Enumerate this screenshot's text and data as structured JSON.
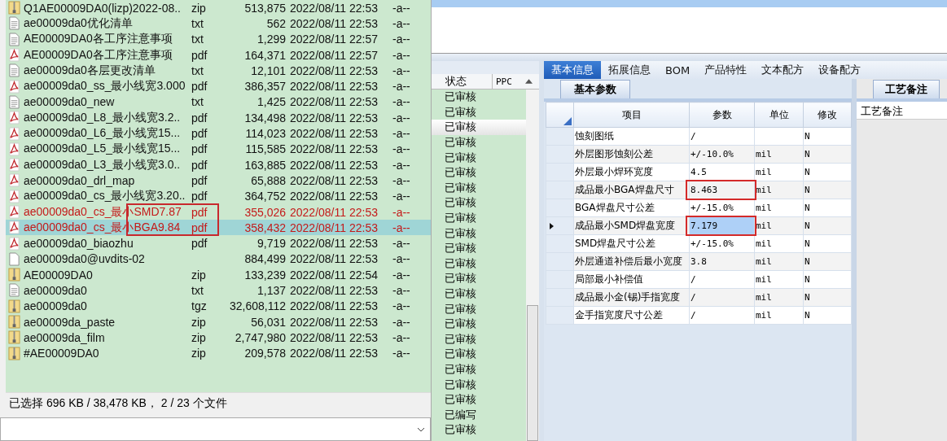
{
  "file_list": {
    "rows": [
      {
        "kind": "archive",
        "name": "Q1AE00009DA0(lizp)2022-08..",
        "type": "zip",
        "size": "513,875",
        "modified": "2022/08/11 22:53",
        "attributes": "-a--",
        "marked": false,
        "selected": false,
        "boxed": false
      },
      {
        "kind": "text",
        "name": "ae00009da0优化清单",
        "type": "txt",
        "size": "562",
        "modified": "2022/08/11 22:53",
        "attributes": "-a--",
        "marked": false,
        "selected": false,
        "boxed": false
      },
      {
        "kind": "text",
        "name": "AE00009DA0各工序注意事项",
        "type": "txt",
        "size": "1,299",
        "modified": "2022/08/11 22:57",
        "attributes": "-a--",
        "marked": false,
        "selected": false,
        "boxed": false
      },
      {
        "kind": "acrobat",
        "name": "AE00009DA0各工序注意事项",
        "type": "pdf",
        "size": "164,371",
        "modified": "2022/08/11 22:57",
        "attributes": "-a--",
        "marked": false,
        "selected": false,
        "boxed": false
      },
      {
        "kind": "text",
        "name": "ae00009da0各层更改清单",
        "type": "txt",
        "size": "12,101",
        "modified": "2022/08/11 22:53",
        "attributes": "-a--",
        "marked": false,
        "selected": false,
        "boxed": false
      },
      {
        "kind": "acrobat",
        "name": "ae00009da0_ss_最小线宽3.000",
        "type": "pdf",
        "size": "386,357",
        "modified": "2022/08/11 22:53",
        "attributes": "-a--",
        "marked": false,
        "selected": false,
        "boxed": false
      },
      {
        "kind": "text",
        "name": "ae00009da0_new",
        "type": "txt",
        "size": "1,425",
        "modified": "2022/08/11 22:53",
        "attributes": "-a--",
        "marked": false,
        "selected": false,
        "boxed": false
      },
      {
        "kind": "acrobat",
        "name": "ae00009da0_L8_最小线宽3.2..",
        "type": "pdf",
        "size": "134,498",
        "modified": "2022/08/11 22:53",
        "attributes": "-a--",
        "marked": false,
        "selected": false,
        "boxed": false
      },
      {
        "kind": "acrobat",
        "name": "ae00009da0_L6_最小线宽15...",
        "type": "pdf",
        "size": "114,023",
        "modified": "2022/08/11 22:53",
        "attributes": "-a--",
        "marked": false,
        "selected": false,
        "boxed": false
      },
      {
        "kind": "acrobat",
        "name": "ae00009da0_L5_最小线宽15...",
        "type": "pdf",
        "size": "115,585",
        "modified": "2022/08/11 22:53",
        "attributes": "-a--",
        "marked": false,
        "selected": false,
        "boxed": false
      },
      {
        "kind": "acrobat",
        "name": "ae00009da0_L3_最小线宽3.0..",
        "type": "pdf",
        "size": "163,885",
        "modified": "2022/08/11 22:53",
        "attributes": "-a--",
        "marked": false,
        "selected": false,
        "boxed": false
      },
      {
        "kind": "acrobat",
        "name": "ae00009da0_drl_map",
        "type": "pdf",
        "size": "65,888",
        "modified": "2022/08/11 22:53",
        "attributes": "-a--",
        "marked": false,
        "selected": false,
        "boxed": false
      },
      {
        "kind": "acrobat",
        "name": "ae00009da0_cs_最小线宽3.20..",
        "type": "pdf",
        "size": "364,752",
        "modified": "2022/08/11 22:53",
        "attributes": "-a--",
        "marked": false,
        "selected": false,
        "boxed": false
      },
      {
        "kind": "acrobat",
        "name": "ae00009da0_cs_最小SMD7.87",
        "type": "pdf",
        "size": "355,026",
        "modified": "2022/08/11 22:53",
        "attributes": "-a--",
        "marked": true,
        "selected": false,
        "boxed": true
      },
      {
        "kind": "acrobat",
        "name": "ae00009da0_cs_最小BGA9.84",
        "type": "pdf",
        "size": "358,432",
        "modified": "2022/08/11 22:53",
        "attributes": "-a--",
        "marked": true,
        "selected": true,
        "boxed": true
      },
      {
        "kind": "acrobat",
        "name": "ae00009da0_biaozhu",
        "type": "pdf",
        "size": "9,719",
        "modified": "2022/08/11 22:53",
        "attributes": "-a--",
        "marked": false,
        "selected": false,
        "boxed": false
      },
      {
        "kind": "plain",
        "name": "ae00009da0@uvdits-02",
        "size": "884,499",
        "modified": "2022/08/11 22:53",
        "attributes": "-a--",
        "marked": false,
        "selected": false,
        "boxed": false
      },
      {
        "kind": "archive",
        "name": "AE00009DA0",
        "type": "zip",
        "size": "133,239",
        "modified": "2022/08/11 22:54",
        "attributes": "-a--",
        "marked": false,
        "selected": false,
        "boxed": false
      },
      {
        "kind": "text",
        "name": "ae00009da0",
        "type": "txt",
        "size": "1,137",
        "modified": "2022/08/11 22:53",
        "attributes": "-a--",
        "marked": false,
        "selected": false,
        "boxed": false
      },
      {
        "kind": "archive",
        "name": "ae00009da0",
        "type": "tgz",
        "size": "32,608,112",
        "modified": "2022/08/11 22:53",
        "attributes": "-a--",
        "marked": false,
        "selected": false,
        "boxed": false
      },
      {
        "kind": "archive",
        "name": "ae00009da_paste",
        "type": "zip",
        "size": "56,031",
        "modified": "2022/08/11 22:53",
        "attributes": "-a--",
        "marked": false,
        "selected": false,
        "boxed": false
      },
      {
        "kind": "archive",
        "name": "ae00009da_film",
        "type": "zip",
        "size": "2,747,980",
        "modified": "2022/08/11 22:53",
        "attributes": "-a--",
        "marked": false,
        "selected": false,
        "boxed": false
      },
      {
        "kind": "archive",
        "name": "#AE00009DA0",
        "type": "zip",
        "size": "209,578",
        "modified": "2022/08/11 22:53",
        "attributes": "-a--",
        "marked": false,
        "selected": false,
        "boxed": false
      }
    ],
    "status_text": "已选择 696 KB / 38,478 KB， 2 / 23 个文件"
  },
  "status_list": {
    "columns": [
      "状态",
      "PPC"
    ],
    "rows": [
      {
        "status": "已审核",
        "selected": false
      },
      {
        "status": "已审核",
        "selected": false
      },
      {
        "status": "已审核",
        "selected": true
      },
      {
        "status": "已审核",
        "selected": false
      },
      {
        "status": "已审核",
        "selected": false
      },
      {
        "status": "已审核",
        "selected": false
      },
      {
        "status": "已审核",
        "selected": false
      },
      {
        "status": "已审核",
        "selected": false
      },
      {
        "status": "已审核",
        "selected": false
      },
      {
        "status": "已审核",
        "selected": false
      },
      {
        "status": "已审核",
        "selected": false
      },
      {
        "status": "已审核",
        "selected": false
      },
      {
        "status": "已审核",
        "selected": false
      },
      {
        "status": "已审核",
        "selected": false
      },
      {
        "status": "已审核",
        "selected": false
      },
      {
        "status": "已审核",
        "selected": false
      },
      {
        "status": "已审核",
        "selected": false
      },
      {
        "status": "已审核",
        "selected": false
      },
      {
        "status": "已审核",
        "selected": false
      },
      {
        "status": "已审核",
        "selected": false
      },
      {
        "status": "已审核",
        "selected": false
      },
      {
        "status": "已编写",
        "selected": false
      },
      {
        "status": "已审核",
        "selected": false
      }
    ]
  },
  "detail": {
    "tabs": [
      {
        "label": "基本信息",
        "selected": true
      },
      {
        "label": "拓展信息",
        "selected": false
      },
      {
        "label": "BOM",
        "selected": false
      },
      {
        "label": "产品特性",
        "selected": false
      },
      {
        "label": "文本配方",
        "selected": false
      },
      {
        "label": "设备配方",
        "selected": false
      }
    ],
    "sub_tab": "基本参数",
    "grid": {
      "columns": [
        "项目",
        "参数",
        "单位",
        "修改"
      ],
      "rows": [
        {
          "item": "蚀刻图纸",
          "param": "/",
          "modified": "N",
          "current": false,
          "boxed": false
        },
        {
          "item": "外层图形蚀刻公差",
          "param": "+/-10.0%",
          "unit": "mil",
          "modified": "N",
          "current": false,
          "boxed": false
        },
        {
          "item": "外层最小焊环宽度",
          "param": "4.5",
          "unit": "mil",
          "modified": "N",
          "current": false,
          "boxed": false
        },
        {
          "item": "成品最小BGA焊盘尺寸",
          "param": "8.463",
          "unit": "mil",
          "modified": "N",
          "current": false,
          "boxed": true
        },
        {
          "item": "BGA焊盘尺寸公差",
          "param": "+/-15.0%",
          "unit": "mil",
          "modified": "N",
          "current": false,
          "boxed": false
        },
        {
          "item": "成品最小SMD焊盘宽度",
          "param": "7.179",
          "unit": "mil",
          "modified": "N",
          "current": true,
          "boxed": true
        },
        {
          "item": "SMD焊盘尺寸公差",
          "param": "+/-15.0%",
          "unit": "mil",
          "modified": "N",
          "current": false,
          "boxed": false
        },
        {
          "item": "外层通道补偿后最小宽度",
          "param": "3.8",
          "unit": "mil",
          "modified": "N",
          "current": false,
          "boxed": false
        },
        {
          "item": "局部最小补偿值",
          "param": "/",
          "unit": "mil",
          "modified": "N",
          "current": false,
          "boxed": false
        },
        {
          "item": "成品最小金(锡)手指宽度",
          "param": "/",
          "unit": "mil",
          "modified": "N",
          "current": false,
          "boxed": false
        },
        {
          "item": "金手指宽度尺寸公差",
          "param": "/",
          "unit": "mil",
          "modified": "N",
          "current": false,
          "boxed": false
        }
      ]
    },
    "notes": {
      "tab": "工艺备注",
      "header": "工艺备注"
    }
  }
}
